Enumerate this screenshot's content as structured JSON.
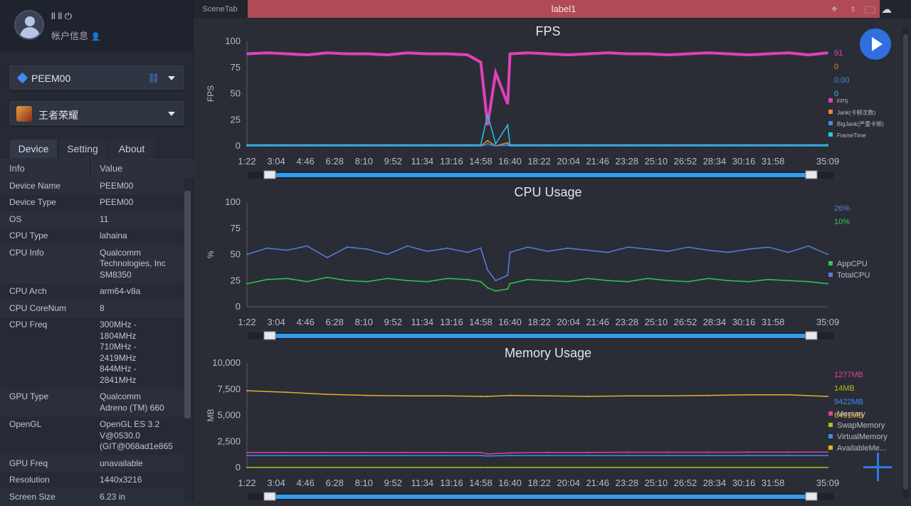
{
  "user": {
    "name": "ll ll ⏻",
    "info": "帐户信息"
  },
  "device_select": {
    "value": "PEEM00"
  },
  "app_select": {
    "value": "王者荣耀"
  },
  "tabs": [
    {
      "label": "Device"
    },
    {
      "label": "Setting"
    },
    {
      "label": "About"
    }
  ],
  "table": {
    "headers": [
      "Info",
      "Value"
    ],
    "rows": [
      {
        "k": "Device Name",
        "v": "PEEM00"
      },
      {
        "k": "Device Type",
        "v": "PEEM00"
      },
      {
        "k": "OS",
        "v": "11"
      },
      {
        "k": "CPU Type",
        "v": "lahaina"
      },
      {
        "k": "CPU Info",
        "v": "Qualcomm\nTechnologies, Inc\nSM8350"
      },
      {
        "k": "CPU Arch",
        "v": "arm64-v8a"
      },
      {
        "k": "CPU CoreNum",
        "v": "8"
      },
      {
        "k": "CPU Freq",
        "v": "300MHz -\n1804MHz\n710MHz -\n2419MHz\n844MHz -\n2841MHz"
      },
      {
        "k": "GPU Type",
        "v": "Qualcomm\nAdreno (TM) 660"
      },
      {
        "k": "OpenGL",
        "v": "OpenGL ES 3.2\nV@0530.0\n(GIT@068ad1e865"
      },
      {
        "k": "GPU Freq",
        "v": "unavailable"
      },
      {
        "k": "Resolution",
        "v": "1440x3216"
      },
      {
        "k": "Screen Size",
        "v": "6.23 in"
      }
    ]
  },
  "topbar": {
    "scene_tab": "SceneTab",
    "label_tab": "label1"
  },
  "colors": {
    "accent": "#2f6fe0",
    "label_tab": "#b04a54",
    "slider": "#2e9cf0"
  },
  "chart_data": [
    {
      "type": "line",
      "title": "FPS",
      "ylabel": "FPS",
      "ylim": [
        0,
        100
      ],
      "yticks": [
        "0",
        "25",
        "50",
        "75",
        "100"
      ],
      "xticks": [
        "1:22",
        "3:04",
        "4:46",
        "6:28",
        "8:10",
        "9:52",
        "11:34",
        "13:16",
        "14:58",
        "16:40",
        "18:22",
        "20:04",
        "21:46",
        "23:28",
        "25:10",
        "26:52",
        "28:34",
        "30:16",
        "31:58",
        "35:09"
      ],
      "x": [
        "1:22",
        "2:32",
        "3:42",
        "4:52",
        "6:02",
        "7:12",
        "8:22",
        "9:32",
        "10:42",
        "11:52",
        "13:02",
        "14:12",
        "14:58",
        "15:22",
        "15:50",
        "16:32",
        "16:40",
        "17:42",
        "18:52",
        "20:02",
        "21:12",
        "22:22",
        "23:32",
        "24:42",
        "25:52",
        "27:02",
        "28:12",
        "29:22",
        "30:32",
        "31:42",
        "32:52",
        "34:02",
        "35:09"
      ],
      "series": [
        {
          "name": "FPS",
          "color": "#e040b8",
          "current": "91",
          "values": [
            88,
            89,
            88,
            87,
            89,
            88,
            88,
            87,
            89,
            88,
            88,
            87,
            80,
            20,
            70,
            40,
            88,
            89,
            88,
            87,
            88,
            89,
            88,
            88,
            87,
            88,
            89,
            88,
            87,
            88,
            89,
            87,
            89
          ]
        },
        {
          "name": "Jank(卡顿次数)",
          "color": "#f08a24",
          "current": "0",
          "values": [
            0,
            0,
            0,
            0,
            0,
            0,
            0,
            0,
            0,
            0,
            0,
            0,
            0,
            5,
            0,
            3,
            0,
            0,
            0,
            0,
            0,
            0,
            0,
            0,
            0,
            0,
            0,
            0,
            0,
            0,
            0,
            0,
            0
          ]
        },
        {
          "name": "BigJank(严重卡顿)",
          "color": "#3a8ff0",
          "current": "0.00",
          "values": [
            0,
            0,
            0,
            0,
            0,
            0,
            0,
            0,
            0,
            0,
            0,
            0,
            0,
            2,
            0,
            1,
            0,
            0,
            0,
            0,
            0,
            0,
            0,
            0,
            0,
            0,
            0,
            0,
            0,
            0,
            0,
            0,
            0
          ]
        },
        {
          "name": "FrameTime",
          "color": "#26c6e8",
          "current": "0",
          "values": [
            1,
            1,
            1,
            1,
            1,
            1,
            1,
            1,
            1,
            1,
            1,
            1,
            1,
            30,
            2,
            20,
            1,
            1,
            1,
            1,
            1,
            1,
            1,
            1,
            1,
            1,
            1,
            1,
            1,
            1,
            1,
            1,
            1
          ]
        }
      ]
    },
    {
      "type": "line",
      "title": "CPU Usage",
      "ylabel": "%",
      "ylim": [
        0,
        100
      ],
      "yticks": [
        "0",
        "25",
        "50",
        "75",
        "100"
      ],
      "xticks": [
        "1:22",
        "3:04",
        "4:46",
        "6:28",
        "8:10",
        "9:52",
        "11:34",
        "13:16",
        "14:58",
        "16:40",
        "18:22",
        "20:04",
        "21:46",
        "23:28",
        "25:10",
        "26:52",
        "28:34",
        "30:16",
        "31:58",
        "35:09"
      ],
      "x": [
        "1:22",
        "2:32",
        "3:42",
        "4:52",
        "6:02",
        "7:12",
        "8:22",
        "9:32",
        "10:42",
        "11:52",
        "13:02",
        "14:12",
        "14:58",
        "15:22",
        "15:50",
        "16:32",
        "16:40",
        "17:42",
        "18:52",
        "20:02",
        "21:12",
        "22:22",
        "23:32",
        "24:42",
        "25:52",
        "27:02",
        "28:12",
        "29:22",
        "30:32",
        "31:42",
        "32:52",
        "34:02",
        "35:09"
      ],
      "series": [
        {
          "name": "AppCPU",
          "color": "#2ec84a",
          "current": "10%",
          "values": [
            22,
            26,
            27,
            24,
            28,
            25,
            24,
            27,
            25,
            24,
            27,
            26,
            24,
            18,
            15,
            17,
            22,
            26,
            25,
            24,
            27,
            25,
            24,
            27,
            25,
            24,
            27,
            25,
            24,
            26,
            25,
            24,
            22
          ]
        },
        {
          "name": "TotalCPU",
          "color": "#5b7be0",
          "current": "26%",
          "values": [
            50,
            56,
            54,
            58,
            47,
            57,
            55,
            50,
            58,
            53,
            56,
            52,
            56,
            35,
            25,
            30,
            52,
            57,
            53,
            56,
            54,
            52,
            57,
            55,
            53,
            57,
            54,
            52,
            55,
            57,
            52,
            58,
            50
          ]
        }
      ]
    },
    {
      "type": "line",
      "title": "Memory Usage",
      "ylabel": "MB",
      "ylim": [
        0,
        10000
      ],
      "yticks": [
        "0",
        "2,500",
        "5,000",
        "7,500",
        "10,000"
      ],
      "xticks": [
        "1:22",
        "3:04",
        "4:46",
        "6:28",
        "8:10",
        "9:52",
        "11:34",
        "13:16",
        "14:58",
        "16:40",
        "18:22",
        "20:04",
        "21:46",
        "23:28",
        "25:10",
        "26:52",
        "28:34",
        "30:16",
        "31:58",
        "35:09"
      ],
      "x": [
        "1:22",
        "3:42",
        "6:02",
        "8:22",
        "10:42",
        "13:02",
        "14:58",
        "15:22",
        "16:40",
        "18:52",
        "21:12",
        "23:32",
        "25:52",
        "28:12",
        "30:32",
        "32:52",
        "35:09"
      ],
      "series": [
        {
          "name": "Memory",
          "color": "#e0409a",
          "current": "1277MB",
          "values": [
            1450,
            1450,
            1450,
            1450,
            1450,
            1450,
            1450,
            1300,
            1400,
            1450,
            1450,
            1460,
            1460,
            1460,
            1470,
            1470,
            1480
          ]
        },
        {
          "name": "SwapMemory",
          "color": "#a8c020",
          "current": "14MB",
          "values": [
            14,
            14,
            14,
            14,
            14,
            14,
            14,
            14,
            14,
            14,
            14,
            14,
            14,
            14,
            14,
            14,
            14
          ]
        },
        {
          "name": "VirtualMemory",
          "color": "#3a8ff0",
          "current": "9422MB",
          "values": [
            1150,
            1150,
            1150,
            1150,
            1150,
            1150,
            1150,
            1100,
            1150,
            1150,
            1150,
            1150,
            1150,
            1150,
            1150,
            1150,
            1150
          ]
        },
        {
          "name": "AvailableMe...",
          "color": "#e8b020",
          "current": "6491MB",
          "values": [
            7350,
            7200,
            7000,
            6900,
            6850,
            6850,
            6800,
            6800,
            6900,
            6850,
            6800,
            6850,
            6850,
            6900,
            6950,
            6950,
            6800
          ]
        }
      ]
    }
  ]
}
